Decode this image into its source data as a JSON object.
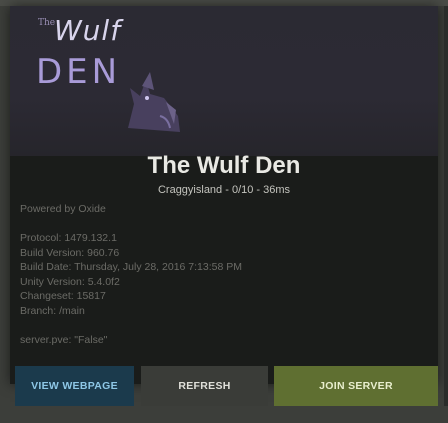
{
  "banner": {
    "logo_small": "The",
    "logo_word": "Wulf",
    "logo_den": "DEN",
    "wolf_icon": "wolf-silhouette-icon"
  },
  "server": {
    "name": "The Wulf Den",
    "subtitle": "Craggyisland - 0/10 - 36ms"
  },
  "info": {
    "powered_by": "Powered by Oxide",
    "protocol": "Protocol: 1479.132.1",
    "build_version": "Build Version: 960.76",
    "build_date": "Build Date: Thursday, July 28, 2016 7:13:58 PM",
    "unity_version": "Unity Version: 5.4.0f2",
    "changeset": "Changeset: 15817",
    "branch": "Branch: /main",
    "server_pve": "server.pve: \"False\""
  },
  "actions": {
    "view_webpage": "VIEW WEBPAGE",
    "refresh": "REFRESH",
    "join_server": "JOIN SERVER"
  },
  "colors": {
    "view_button": "#1b3a4c",
    "refresh_button": "#3a3c38",
    "join_button": "#5f6f31"
  }
}
